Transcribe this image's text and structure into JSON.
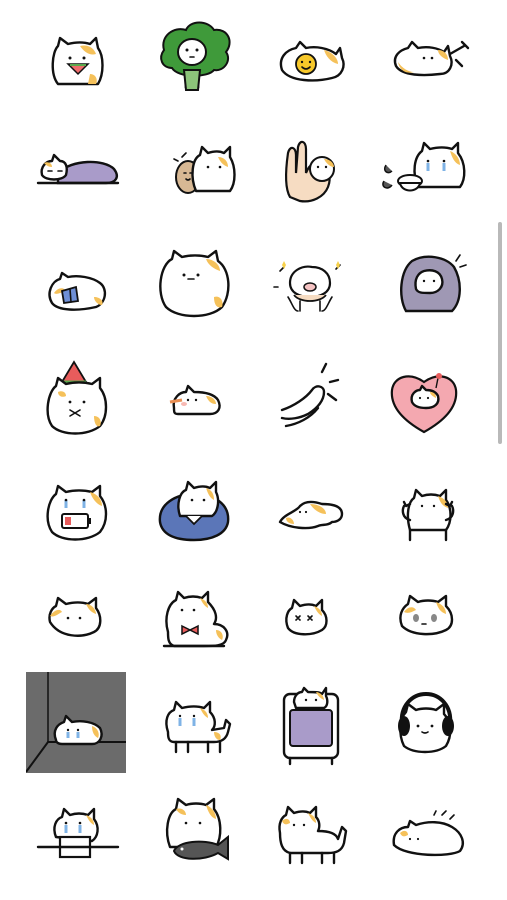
{
  "sticker_grid": {
    "columns": 4,
    "rows": 8,
    "stickers": [
      {
        "name": "cat-eating-watermelon"
      },
      {
        "name": "cat-in-broccoli"
      },
      {
        "name": "cat-fried-egg"
      },
      {
        "name": "cat-pointing"
      },
      {
        "name": "cat-sleeping-blanket"
      },
      {
        "name": "cat-hugging-potato"
      },
      {
        "name": "hand-holding-cat"
      },
      {
        "name": "cat-crying-bowl"
      },
      {
        "name": "cat-reading-book"
      },
      {
        "name": "cat-round-blob"
      },
      {
        "name": "pig-cat-held-hands"
      },
      {
        "name": "cat-wrapped-blanket"
      },
      {
        "name": "cat-watermelon-hat"
      },
      {
        "name": "cat-lying-blush"
      },
      {
        "name": "paw-wave"
      },
      {
        "name": "cat-in-heart"
      },
      {
        "name": "cat-low-battery"
      },
      {
        "name": "cat-in-blue-shirt"
      },
      {
        "name": "cat-melted-puddle"
      },
      {
        "name": "cat-arms-up"
      },
      {
        "name": "cat-face-smile"
      },
      {
        "name": "cat-with-bow"
      },
      {
        "name": "cat-face-sparkle"
      },
      {
        "name": "cat-face-grumpy"
      },
      {
        "name": "cat-in-dark-corner"
      },
      {
        "name": "cat-crying-walking"
      },
      {
        "name": "cat-in-tv"
      },
      {
        "name": "cat-headphones"
      },
      {
        "name": "cat-crying-box"
      },
      {
        "name": "cat-hugging-fish"
      },
      {
        "name": "cat-walking"
      },
      {
        "name": "cat-sleeping-lump"
      }
    ]
  },
  "colors": {
    "background": "#ffffff",
    "spot_orange": "#f5c15a",
    "broccoli_green": "#3f9a3a",
    "blanket_purple": "#a99bc9",
    "shirt_blue": "#5b76b8",
    "heart_pink": "#f4a8b0",
    "dark_corner": "#6b6b6b",
    "scrollbar": "#b9b9b9"
  }
}
